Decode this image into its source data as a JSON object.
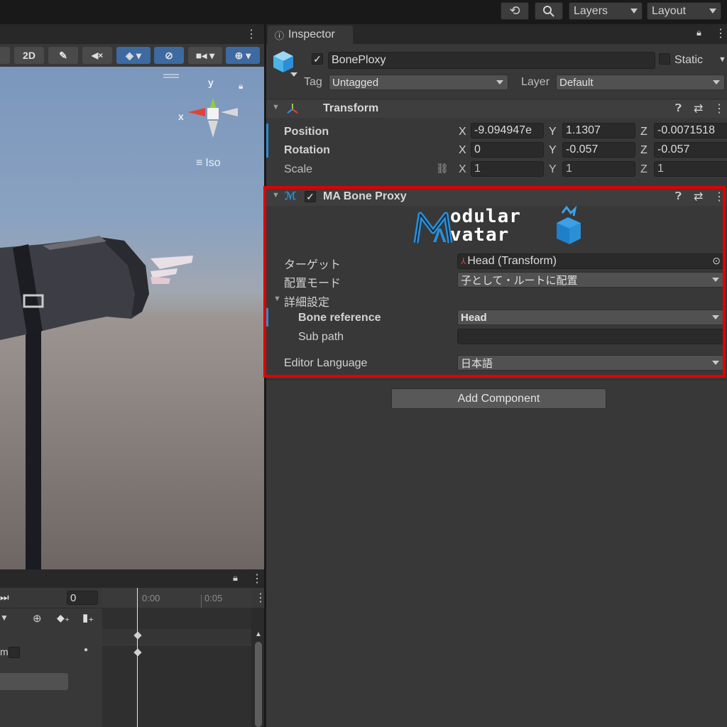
{
  "topbar": {
    "layers_label": "Layers",
    "layout_label": "Layout"
  },
  "scene": {
    "toolbar_2d": "2D",
    "axis_y": "y",
    "axis_x": "x",
    "iso_label": "Iso"
  },
  "timeline": {
    "frame_value": "0",
    "tick_0": "0:00",
    "tick_5": "0:05",
    "truncated_label": "m"
  },
  "inspector": {
    "tab_label": "Inspector",
    "object_name": "BonePloxy",
    "static_label": "Static",
    "tag_label": "Tag",
    "tag_value": "Untagged",
    "layer_label": "Layer",
    "layer_value": "Default"
  },
  "transform": {
    "title": "Transform",
    "position_label": "Position",
    "rotation_label": "Rotation",
    "scale_label": "Scale",
    "axis_x": "X",
    "axis_y": "Y",
    "axis_z": "Z",
    "position": {
      "x": "-9.094947e",
      "y": "1.1307",
      "z": "-0.0071518"
    },
    "rotation": {
      "x": "0",
      "y": "-0.057",
      "z": "-0.057"
    },
    "scale": {
      "x": "1",
      "y": "1",
      "z": "1"
    }
  },
  "bone_proxy": {
    "title": "MA Bone Proxy",
    "logo_line1": "odular",
    "logo_line2": "vatar",
    "target_label": "ターゲット",
    "target_value": "Head (Transform)",
    "placement_label": "配置モード",
    "placement_value": "子として・ルートに配置",
    "advanced_label": "詳細設定",
    "bone_ref_label": "Bone reference",
    "bone_ref_value": "Head",
    "subpath_label": "Sub path",
    "subpath_value": "",
    "editor_lang_label": "Editor Language",
    "editor_lang_value": "日本語"
  },
  "add_component_label": "Add Component",
  "colors": {
    "highlight_border": "#e00000",
    "accent_blue": "#2b8fd6",
    "panel_bg": "#383838"
  }
}
